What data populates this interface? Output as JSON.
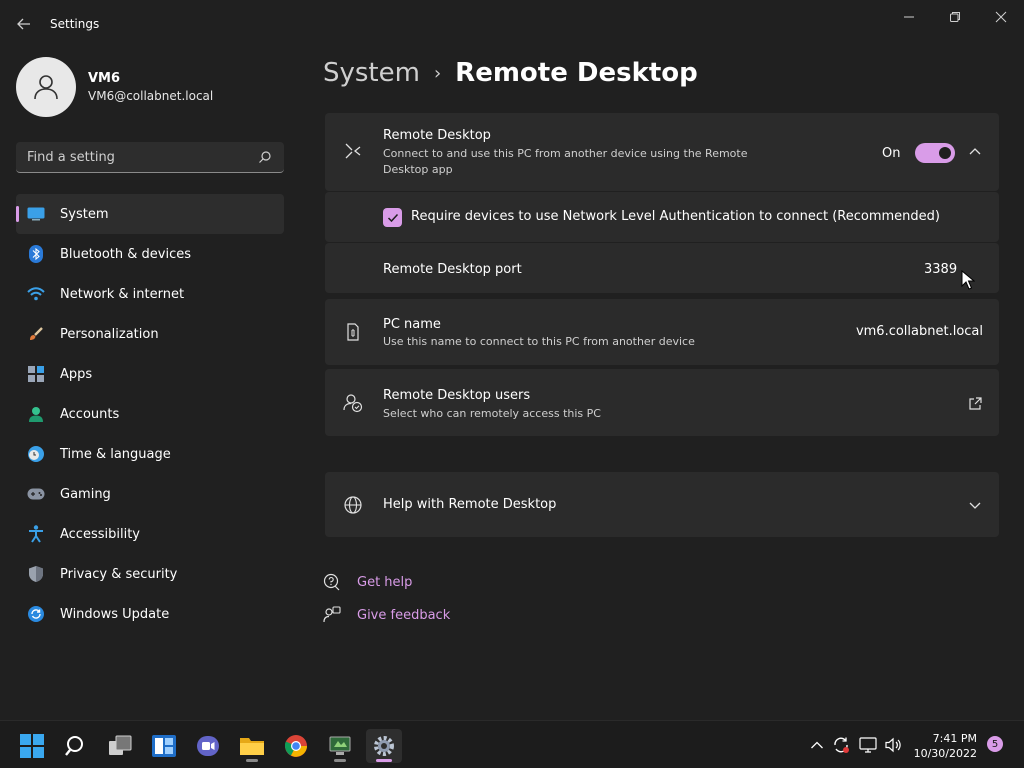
{
  "window": {
    "title": "Settings"
  },
  "profile": {
    "name": "VM6",
    "email": "VM6@collabnet.local"
  },
  "search": {
    "placeholder": "Find a setting"
  },
  "sidebar": {
    "items": [
      {
        "label": "System",
        "icon": "system-icon",
        "active": true
      },
      {
        "label": "Bluetooth & devices",
        "icon": "bluetooth-icon"
      },
      {
        "label": "Network & internet",
        "icon": "wifi-icon"
      },
      {
        "label": "Personalization",
        "icon": "brush-icon"
      },
      {
        "label": "Apps",
        "icon": "apps-icon"
      },
      {
        "label": "Accounts",
        "icon": "accounts-icon"
      },
      {
        "label": "Time & language",
        "icon": "clock-globe-icon"
      },
      {
        "label": "Gaming",
        "icon": "gamepad-icon"
      },
      {
        "label": "Accessibility",
        "icon": "accessibility-icon"
      },
      {
        "label": "Privacy & security",
        "icon": "shield-icon"
      },
      {
        "label": "Windows Update",
        "icon": "update-icon"
      }
    ]
  },
  "breadcrumb": {
    "parent": "System",
    "separator": "›",
    "current": "Remote Desktop"
  },
  "remote_desktop": {
    "title": "Remote Desktop",
    "description": "Connect to and use this PC from another device using the Remote Desktop app",
    "toggle_label": "On",
    "toggle_on": true,
    "nla_label": "Require devices to use Network Level Authentication to connect (Recommended)",
    "nla_checked": true,
    "port_label": "Remote Desktop port",
    "port_value": "3389"
  },
  "pc_name": {
    "title": "PC name",
    "description": "Use this name to connect to this PC from another device",
    "value": "vm6.collabnet.local"
  },
  "rd_users": {
    "title": "Remote Desktop users",
    "description": "Select who can remotely access this PC"
  },
  "help": {
    "title": "Help with Remote Desktop"
  },
  "links": {
    "get_help": "Get help",
    "give_feedback": "Give feedback"
  },
  "taskbar": {
    "time": "7:41 PM",
    "date": "10/30/2022",
    "notification_count": "5"
  },
  "colors": {
    "accent": "#d99ce8",
    "background": "#202020",
    "card": "#2b2b2b"
  }
}
